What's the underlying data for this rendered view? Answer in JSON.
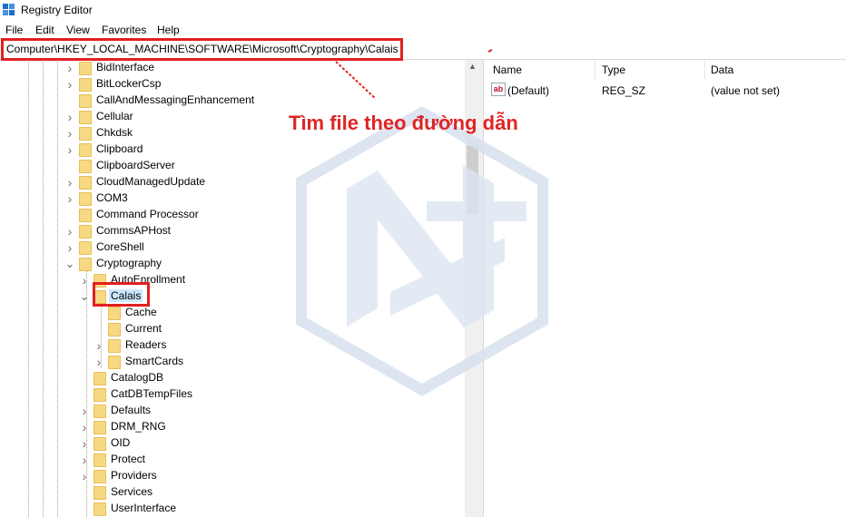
{
  "window": {
    "title": "Registry Editor"
  },
  "menu": [
    "File",
    "Edit",
    "View",
    "Favorites",
    "Help"
  ],
  "address": {
    "path": "Computer\\HKEY_LOCAL_MACHINE\\SOFTWARE\\Microsoft\\Cryptography\\Calais"
  },
  "tree": [
    {
      "label": "BidInterface",
      "level": 1,
      "expander": "collapsed"
    },
    {
      "label": "BitLockerCsp",
      "level": 1,
      "expander": "collapsed"
    },
    {
      "label": "CallAndMessagingEnhancement",
      "level": 1,
      "expander": "none"
    },
    {
      "label": "Cellular",
      "level": 1,
      "expander": "collapsed"
    },
    {
      "label": "Chkdsk",
      "level": 1,
      "expander": "collapsed"
    },
    {
      "label": "Clipboard",
      "level": 1,
      "expander": "collapsed"
    },
    {
      "label": "ClipboardServer",
      "level": 1,
      "expander": "none"
    },
    {
      "label": "CloudManagedUpdate",
      "level": 1,
      "expander": "collapsed"
    },
    {
      "label": "COM3",
      "level": 1,
      "expander": "collapsed"
    },
    {
      "label": "Command Processor",
      "level": 1,
      "expander": "none"
    },
    {
      "label": "CommsAPHost",
      "level": 1,
      "expander": "collapsed"
    },
    {
      "label": "CoreShell",
      "level": 1,
      "expander": "collapsed"
    },
    {
      "label": "Cryptography",
      "level": 1,
      "expander": "expanded"
    },
    {
      "label": "AutoEnrollment",
      "level": 2,
      "expander": "collapsed"
    },
    {
      "label": "Calais",
      "level": 2,
      "expander": "expanded",
      "selected": true
    },
    {
      "label": "Cache",
      "level": 3,
      "expander": "none"
    },
    {
      "label": "Current",
      "level": 3,
      "expander": "none"
    },
    {
      "label": "Readers",
      "level": 3,
      "expander": "collapsed"
    },
    {
      "label": "SmartCards",
      "level": 3,
      "expander": "collapsed"
    },
    {
      "label": "CatalogDB",
      "level": 2,
      "expander": "none"
    },
    {
      "label": "CatDBTempFiles",
      "level": 2,
      "expander": "none"
    },
    {
      "label": "Defaults",
      "level": 2,
      "expander": "collapsed"
    },
    {
      "label": "DRM_RNG",
      "level": 2,
      "expander": "collapsed"
    },
    {
      "label": "OID",
      "level": 2,
      "expander": "collapsed"
    },
    {
      "label": "Protect",
      "level": 2,
      "expander": "collapsed"
    },
    {
      "label": "Providers",
      "level": 2,
      "expander": "collapsed"
    },
    {
      "label": "Services",
      "level": 2,
      "expander": "none"
    },
    {
      "label": "UserInterface",
      "level": 2,
      "expander": "none"
    }
  ],
  "values_pane": {
    "columns": [
      "Name",
      "Type",
      "Data"
    ],
    "rows": [
      {
        "name": "(Default)",
        "type": "REG_SZ",
        "data": "(value not set)",
        "icon": "string-value-icon"
      }
    ]
  },
  "annotation": {
    "text": "Tìm file theo đường dẫn",
    "color": "#e02424"
  },
  "colors": {
    "highlight": "#e02020",
    "selection": "#cce8ff",
    "folder": "#f7d983"
  }
}
